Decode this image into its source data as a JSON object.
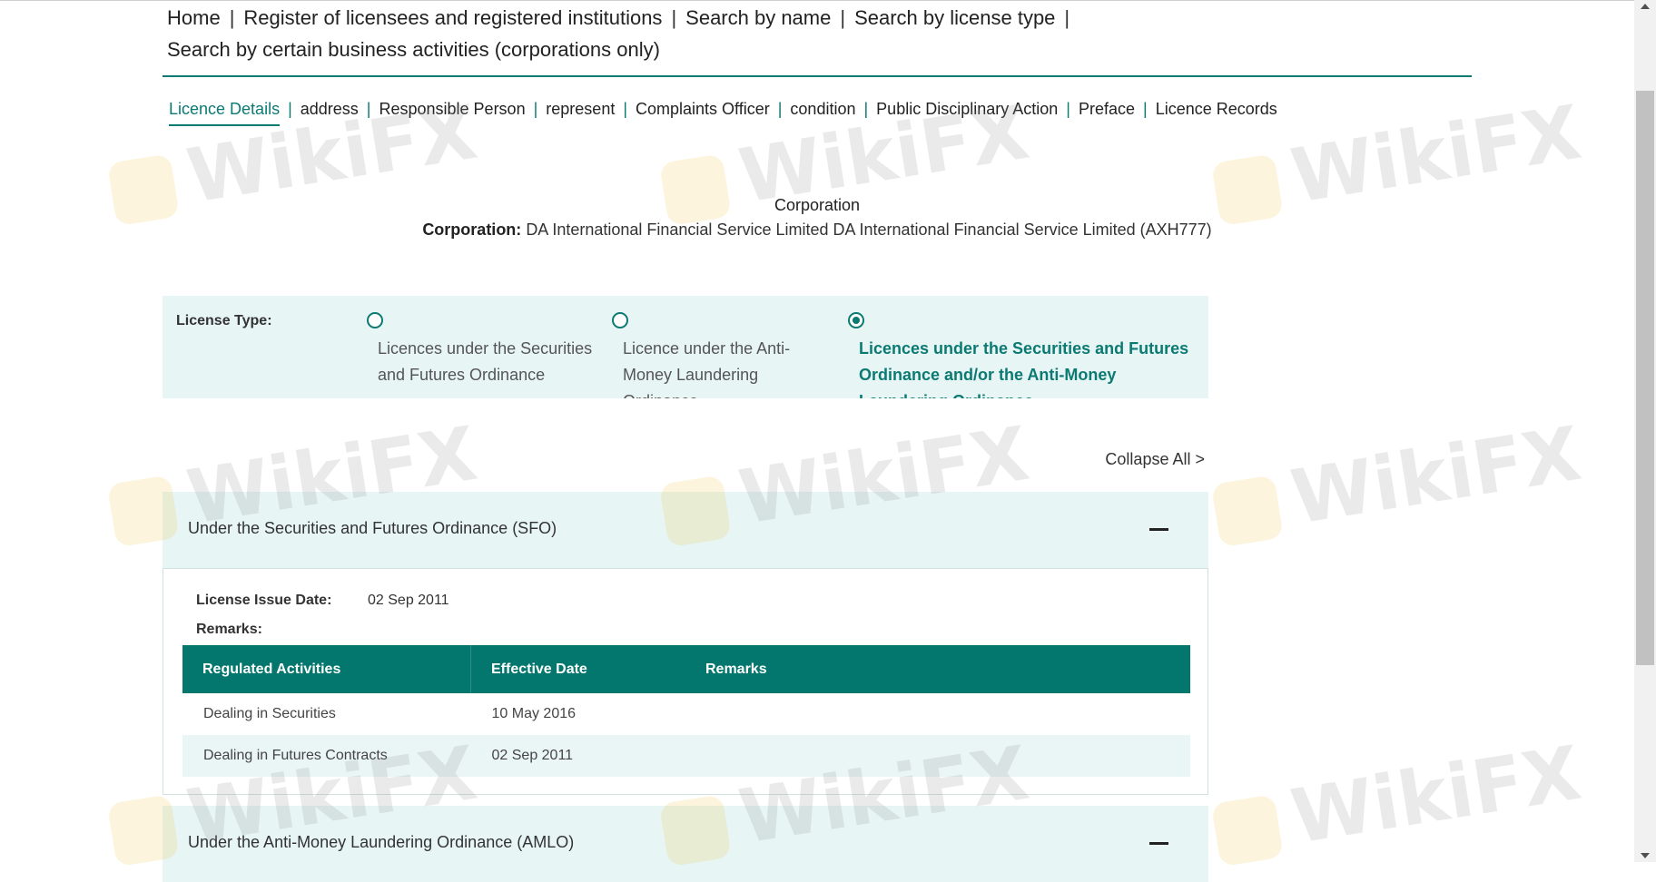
{
  "top_nav": {
    "items": [
      "Home",
      "Register of licensees and registered institutions",
      "Search by name",
      "Search by license type",
      "Search by certain business activities (corporations only)"
    ]
  },
  "sub_nav": {
    "items": [
      "Licence Details",
      "address",
      "Responsible Person",
      "represent",
      "Complaints Officer",
      "condition",
      "Public Disciplinary Action",
      "Preface",
      "Licence Records"
    ],
    "active": "Licence Details"
  },
  "heading": {
    "title": "Corporation",
    "corp_label": "Corporation:",
    "corp_value": "DA International Financial Service Limited DA International Financial Service Limited (AXH777)"
  },
  "license_type": {
    "label": "License Type:",
    "options": [
      "Licences under the Securities and Futures Ordinance",
      "Licence under the Anti-Money Laundering Ordinance",
      "Licences under the Securities and Futures Ordinance and/or the Anti-Money Laundering Ordinance"
    ],
    "selected_index": 2
  },
  "collapse_all": "Collapse All >",
  "sections": [
    {
      "title": "Under the Securities and Futures Ordinance (SFO)",
      "issue_date_label": "License Issue Date:",
      "issue_date": "02 Sep 2011",
      "remarks_label": "Remarks:",
      "table": {
        "headers": [
          "Regulated Activities",
          "Effective Date",
          "Remarks"
        ],
        "rows": [
          [
            "Dealing in Securities",
            "10 May 2016",
            ""
          ],
          [
            "Dealing in Futures Contracts",
            "02 Sep 2011",
            ""
          ]
        ]
      }
    },
    {
      "title": "Under the Anti-Money Laundering Ordinance (AMLO)"
    }
  ],
  "watermark": "WikiFX",
  "colors": {
    "accent": "#0b7a73",
    "table_header": "#03766e",
    "panel_bg": "#e7f5f4"
  }
}
